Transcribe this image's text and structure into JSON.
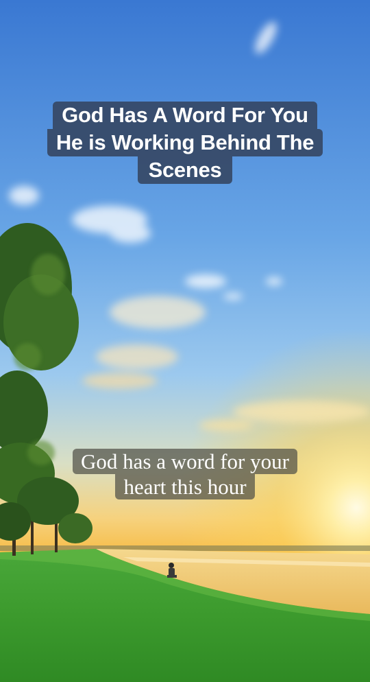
{
  "video": {
    "title_lines": [
      "God Has A Word For You",
      "He is Working Behind The",
      "Scenes"
    ],
    "subtitle_lines": [
      "God has a word for your",
      "heart this hour"
    ]
  },
  "colors": {
    "sky_top": "#3f7fd6",
    "sky_mid": "#8fc0ea",
    "horizon_glow": "#fbd35a",
    "sun": "#fff6c8",
    "water": "#f3c56a",
    "grass": "#3e9e2f",
    "title_bg": "#344460",
    "subtitle_bg": "#505048"
  }
}
